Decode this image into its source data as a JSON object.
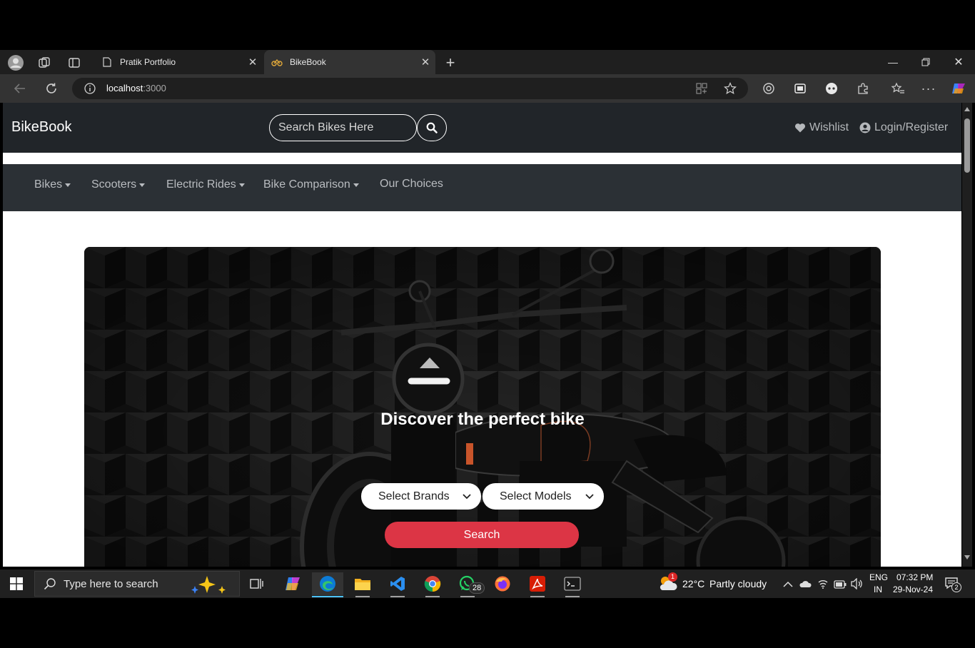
{
  "browser": {
    "tabs": [
      {
        "title": "Pratik Portfolio",
        "active": false
      },
      {
        "title": "BikeBook",
        "active": true
      }
    ],
    "url_host": "localhost",
    "url_port": ":3000"
  },
  "site": {
    "brand": "BikeBook",
    "search_placeholder": "Search Bikes Here",
    "wishlist_label": "Wishlist",
    "login_label": "Login/Register",
    "menu": [
      {
        "label": "Bikes",
        "dropdown": true
      },
      {
        "label": "Scooters",
        "dropdown": true
      },
      {
        "label": "Electric Rides",
        "dropdown": true
      },
      {
        "label": "Bike Comparison",
        "dropdown": true
      },
      {
        "label": "Our Choices",
        "dropdown": false
      }
    ],
    "hero": {
      "title": "Discover the perfect bike",
      "brand_select": "Select Brands",
      "model_select": "Select Models",
      "search_button": "Search"
    }
  },
  "taskbar": {
    "search_placeholder": "Type here to search",
    "whatsapp_badge": "28",
    "weather_badge": "1",
    "weather_temp": "22°C",
    "weather_desc": "Partly cloudy",
    "lang_top": "ENG",
    "lang_bottom": "IN",
    "time": "07:32 PM",
    "date": "29-Nov-24",
    "notification_count": "2"
  },
  "colors": {
    "navbar": "#212529",
    "subnav": "#2b3035",
    "search_button": "#dc3545"
  }
}
